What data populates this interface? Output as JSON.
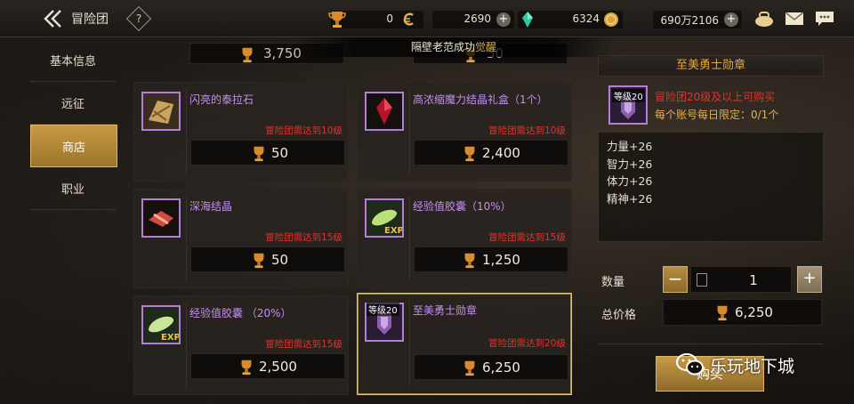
{
  "header": {
    "title": "冒险团",
    "help": "?",
    "currencies": [
      {
        "name": "trophy-currency",
        "value": "0",
        "icon": "trophy-icon"
      },
      {
        "name": "gold-coupon",
        "value": "2690",
        "icon": "gold-c-icon"
      },
      {
        "name": "crystal",
        "value": "6324",
        "icon": "green-crystal-icon"
      },
      {
        "name": "gold",
        "value": "690万2106",
        "icon": "gold-coin-icon"
      }
    ]
  },
  "notice": {
    "prefix": "隔壁老范成功",
    "highlight": "觉醒"
  },
  "sidebar": {
    "items": [
      {
        "label": "基本信息"
      },
      {
        "label": "远征"
      },
      {
        "label": "商店"
      },
      {
        "label": "职业"
      }
    ],
    "active_index": 2
  },
  "shop": {
    "partial_prices": [
      "3,750",
      "50"
    ],
    "items": [
      {
        "name": "闪亮的泰拉石",
        "requirement": "冒险团需达到10级",
        "price": "50",
        "icon": "terra-stone-icon"
      },
      {
        "name": "高浓缩魔力结晶礼盒（1个）",
        "requirement": "冒险团需达到10级",
        "price": "2,400",
        "icon": "magic-crystal-box-icon"
      },
      {
        "name": "深海结晶",
        "requirement": "冒险团需达到15级",
        "price": "50",
        "icon": "deep-sea-crystal-icon"
      },
      {
        "name": "经验值胶囊（10%）",
        "requirement": "冒险团需达到15级",
        "price": "1,250",
        "icon": "exp-capsule-icon"
      },
      {
        "name": "经验值胶囊 （20%）",
        "requirement": "冒险团需达到15级",
        "price": "2,500",
        "icon": "exp-capsule-icon"
      },
      {
        "name": "至美勇士勋章",
        "requirement": "冒险团需达到20级",
        "price": "6,250",
        "icon": "warrior-medal-icon",
        "level_badge": "等级20",
        "selected": true
      }
    ]
  },
  "detail": {
    "title": "至美勇士勋章",
    "level_badge": "等级20",
    "requirement": "冒险团20级及以上可购买",
    "limit": "每个账号每日限定：0/1个",
    "stats": [
      "力量+26",
      "智力+26",
      "体力+26",
      "精神+26"
    ],
    "quantity_label": "数量",
    "quantity": "1",
    "total_label": "总价格",
    "total": "6,250",
    "buy_label": "购买"
  },
  "watermark": {
    "text": "乐玩地下城"
  },
  "colors": {
    "accent_gold": "#c79a45",
    "requirement_red": "#e5322c",
    "item_purple": "#c48ef0",
    "title_orange": "#e3a83d"
  }
}
